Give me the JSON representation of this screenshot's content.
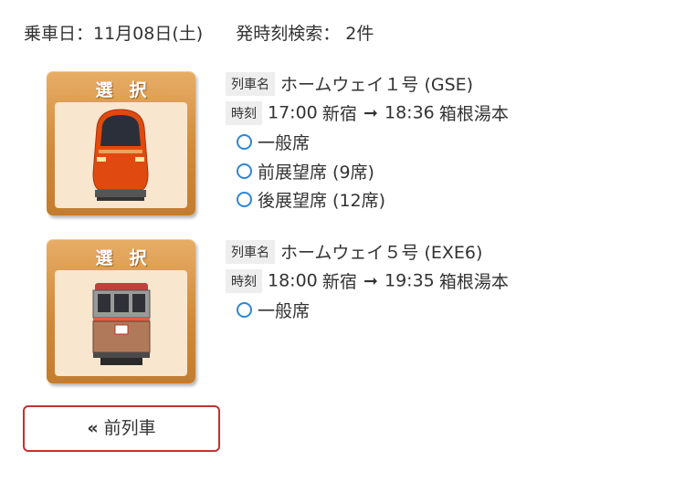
{
  "header": {
    "date_text": "乗車日：11月08日(土)",
    "search_text": "発時刻検索： 2件"
  },
  "trains": [
    {
      "select_label": "選択",
      "name_tag": "列車名",
      "name": "ホームウェイ１号 (GSE)",
      "time_tag": "時刻",
      "dep_time": "17:00",
      "dep_station": "新宿",
      "arrow": "➞",
      "arr_time": "18:36",
      "arr_station": "箱根湯本",
      "seats": [
        "一般席",
        "前展望席 (9席)",
        "後展望席 (12席)"
      ]
    },
    {
      "select_label": "選択",
      "name_tag": "列車名",
      "name": "ホームウェイ５号 (EXE6)",
      "time_tag": "時刻",
      "dep_time": "18:00",
      "dep_station": "新宿",
      "arrow": "➞",
      "arr_time": "19:35",
      "arr_station": "箱根湯本",
      "seats": [
        "一般席"
      ]
    }
  ],
  "prev_button": {
    "icon": "«",
    "label": "前列車"
  },
  "colors": {
    "radio": "#2f86d3",
    "prev_border": "#c0332f",
    "select_button": "#d08a3a",
    "tag_bg": "#eeeeee"
  },
  "icons": {
    "train1": "romancecar-gse-front-icon",
    "train2": "romancecar-exe-front-icon",
    "prev": "double-chevron-left-icon"
  }
}
